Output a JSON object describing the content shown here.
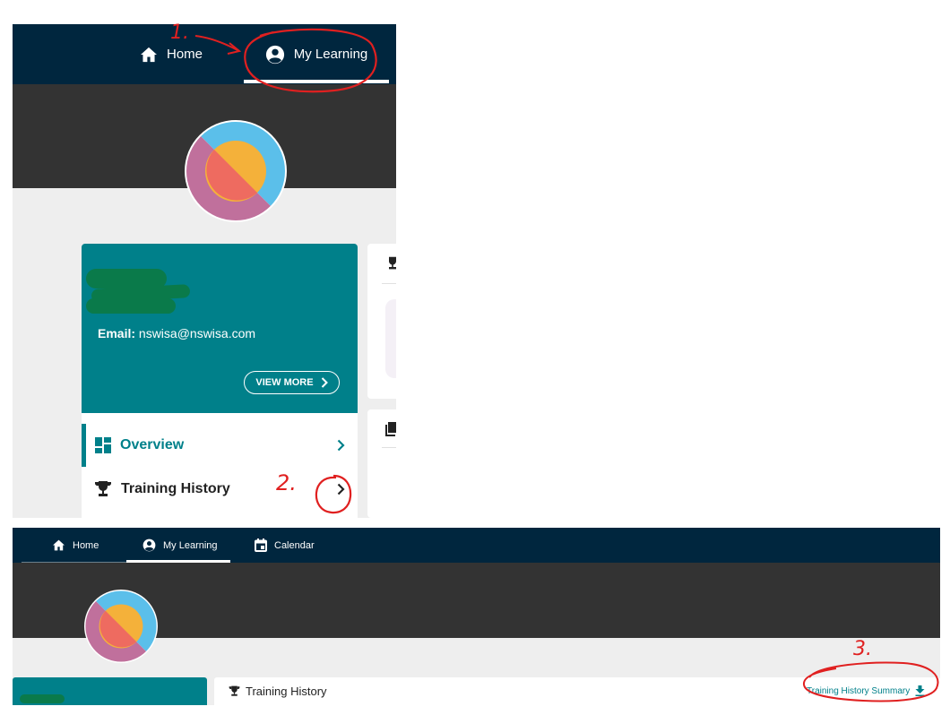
{
  "panel1": {
    "nav": {
      "home_label": "Home",
      "learning_label": "My Learning"
    },
    "profile": {
      "email_label": "Email:",
      "email_value": "nswisa@nswisa.com",
      "view_more_label": "VIEW MORE"
    },
    "menu": {
      "items": [
        {
          "label": "Overview",
          "icon": "dashboard-icon"
        },
        {
          "label": "Training History",
          "icon": "trophy-icon"
        }
      ]
    }
  },
  "panel2": {
    "nav": {
      "home_label": "Home",
      "learning_label": "My Learning",
      "calendar_label": "Calendar"
    },
    "training_history": {
      "title": "Training History",
      "summary_link": "Training History Summary",
      "summary_icon": "download-icon"
    }
  },
  "annotations": {
    "step1": "1.",
    "step2": "2.",
    "step3": "3."
  },
  "colors": {
    "nav": "#00263e",
    "banner": "#333333",
    "accent": "#00808a",
    "annotation": "#e02020"
  }
}
